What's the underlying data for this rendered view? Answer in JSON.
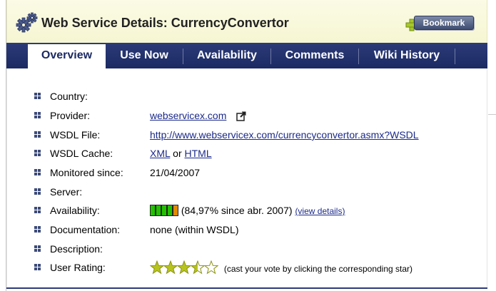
{
  "header": {
    "title": "Web Service Details: CurrencyConvertor",
    "bookmark_label": "Bookmark"
  },
  "tabs": [
    {
      "label": "Overview",
      "active": true
    },
    {
      "label": "Use Now",
      "active": false
    },
    {
      "label": "Availability",
      "active": false
    },
    {
      "label": "Comments",
      "active": false
    },
    {
      "label": "Wiki History",
      "active": false
    }
  ],
  "details": {
    "country_label": "Country:",
    "country_value": "",
    "provider_label": "Provider:",
    "provider_link": "webservicex.com",
    "wsdl_file_label": "WSDL File:",
    "wsdl_file_link": "http://www.webservicex.com/currencyconvertor.asmx?WSDL",
    "wsdl_cache_label": "WSDL Cache:",
    "wsdl_cache_xml": "XML",
    "wsdl_cache_or": "or",
    "wsdl_cache_html": "HTML",
    "monitored_label": "Monitored since:",
    "monitored_value": "21/04/2007",
    "server_label": "Server:",
    "server_value": "",
    "availability_label": "Availability:",
    "availability_text": "(84,97% since abr. 2007)",
    "availability_segments": [
      "#22c000",
      "#22c000",
      "#22c000",
      "#22c000",
      "#e08a00"
    ],
    "availability_details_link": "(view details)",
    "documentation_label": "Documentation:",
    "documentation_value": "none (within WSDL)",
    "description_label": "Description:",
    "description_value": "",
    "rating_label": "User Rating:",
    "rating_value": 3.5,
    "rating_max": 5,
    "rating_hint": "(cast your vote by clicking the corresponding star)"
  },
  "colors": {
    "nav_bg": "#1b2a63",
    "link": "#1b2a8a",
    "star_fill": "#b8c41e",
    "header_bg": "#f6f6d2"
  },
  "icons": [
    "gear-icon",
    "bookmark-plus-icon",
    "external-link-icon",
    "bullet-icon",
    "star-icon"
  ]
}
